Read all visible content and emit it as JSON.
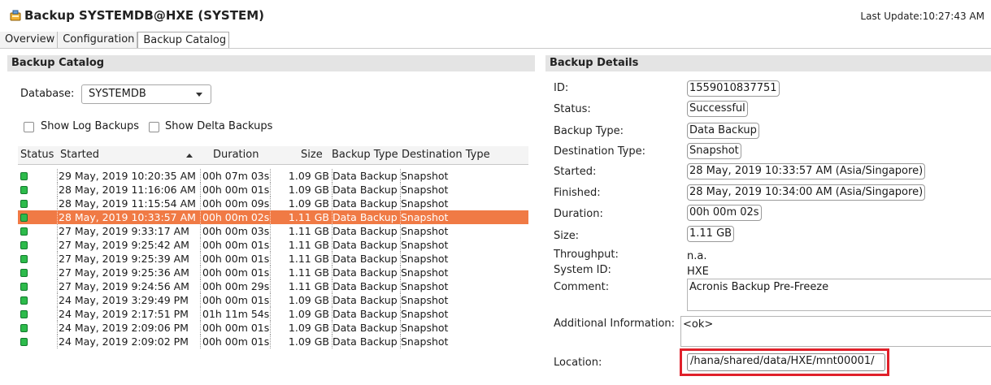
{
  "window": {
    "title": "Backup SYSTEMDB@HXE (SYSTEM)",
    "icon": "backup-icon",
    "last_update": "Last Update:10:27:43 AM"
  },
  "tabs": [
    {
      "label": "Overview",
      "active": false
    },
    {
      "label": "Configuration",
      "active": false
    },
    {
      "label": "Backup Catalog",
      "active": true
    }
  ],
  "catalog": {
    "header": "Backup Catalog",
    "database_label": "Database:",
    "database_value": "SYSTEMDB",
    "show_log_backups": "Show Log Backups",
    "show_delta_backups": "Show Delta Backups",
    "columns": [
      "Status",
      "Started",
      "Duration",
      "Size",
      "Backup Type",
      "Destination Type"
    ],
    "rows": [
      {
        "started": "29 May, 2019 10:20:35 AM",
        "duration": "00h 07m 03s",
        "size": "1.09 GB",
        "type": "Data Backup",
        "dest": "Snapshot"
      },
      {
        "started": "28 May, 2019 11:16:06 AM",
        "duration": "00h 00m 01s",
        "size": "1.09 GB",
        "type": "Data Backup",
        "dest": "Snapshot"
      },
      {
        "started": "28 May, 2019 11:15:54 AM",
        "duration": "00h 00m 09s",
        "size": "1.09 GB",
        "type": "Data Backup",
        "dest": "Snapshot"
      },
      {
        "started": "28 May, 2019 10:33:57 AM",
        "duration": "00h 00m 02s",
        "size": "1.11 GB",
        "type": "Data Backup",
        "dest": "Snapshot"
      },
      {
        "started": "27 May, 2019 9:33:17 AM",
        "duration": "00h 00m 03s",
        "size": "1.11 GB",
        "type": "Data Backup",
        "dest": "Snapshot"
      },
      {
        "started": "27 May, 2019 9:25:42 AM",
        "duration": "00h 00m 01s",
        "size": "1.11 GB",
        "type": "Data Backup",
        "dest": "Snapshot"
      },
      {
        "started": "27 May, 2019 9:25:39 AM",
        "duration": "00h 00m 01s",
        "size": "1.11 GB",
        "type": "Data Backup",
        "dest": "Snapshot"
      },
      {
        "started": "27 May, 2019 9:25:36 AM",
        "duration": "00h 00m 01s",
        "size": "1.11 GB",
        "type": "Data Backup",
        "dest": "Snapshot"
      },
      {
        "started": "27 May, 2019 9:24:56 AM",
        "duration": "00h 00m 29s",
        "size": "1.11 GB",
        "type": "Data Backup",
        "dest": "Snapshot"
      },
      {
        "started": "24 May, 2019 3:29:49 PM",
        "duration": "00h 00m 01s",
        "size": "1.09 GB",
        "type": "Data Backup",
        "dest": "Snapshot"
      },
      {
        "started": "24 May, 2019 2:17:51 PM",
        "duration": "01h 11m 54s",
        "size": "1.09 GB",
        "type": "Data Backup",
        "dest": "Snapshot"
      },
      {
        "started": "24 May, 2019 2:09:06 PM",
        "duration": "00h 00m 01s",
        "size": "1.09 GB",
        "type": "Data Backup",
        "dest": "Snapshot"
      },
      {
        "started": "24 May, 2019 2:09:02 PM",
        "duration": "00h 00m 01s",
        "size": "1.09 GB",
        "type": "Data Backup",
        "dest": "Snapshot"
      }
    ],
    "selected_index": 3
  },
  "details": {
    "header": "Backup Details",
    "id_label": "ID:",
    "id": "1559010837751",
    "status_label": "Status:",
    "status": "Successful",
    "backup_type_label": "Backup Type:",
    "backup_type": "Data Backup",
    "destination_type_label": "Destination Type:",
    "destination_type": "Snapshot",
    "started_label": "Started:",
    "started": "28 May, 2019 10:33:57 AM (Asia/Singapore)",
    "finished_label": "Finished:",
    "finished": "28 May, 2019 10:34:00 AM (Asia/Singapore)",
    "duration_label": "Duration:",
    "duration": "00h 00m 02s",
    "size_label": "Size:",
    "size": "1.11 GB",
    "throughput_label": "Throughput:",
    "throughput": "n.a.",
    "system_id_label": "System ID:",
    "system_id": "HXE",
    "comment_label": "Comment:",
    "comment": "Acronis Backup Pre-Freeze",
    "additional_info_label": "Additional Information:",
    "additional_info": "<ok>",
    "location_label": "Location:",
    "location": "/hana/shared/data/HXE/mnt00001/"
  },
  "colors": {
    "selected_row": "#f07a45",
    "status_ok": "#2dbb4b",
    "highlight_box": "#e0202a",
    "section_header_bg": "#e4e4e4"
  }
}
